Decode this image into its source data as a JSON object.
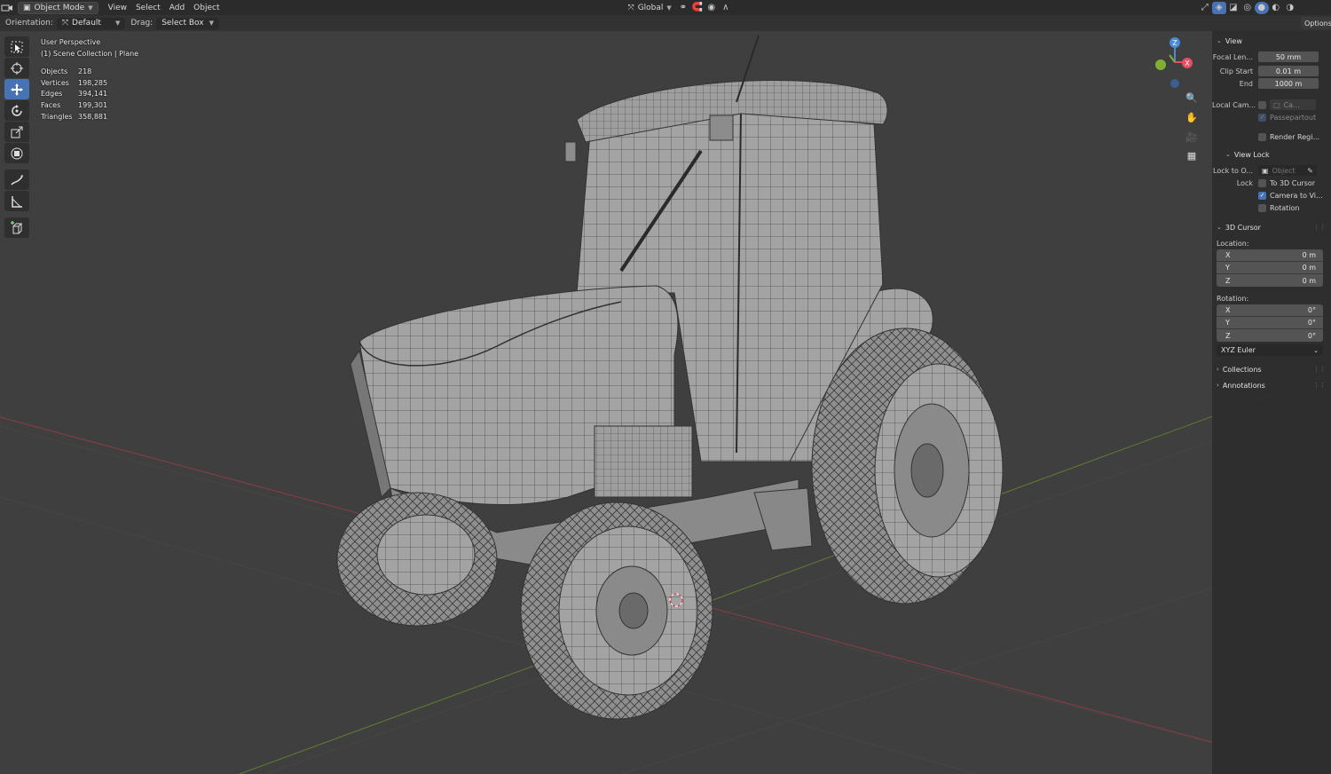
{
  "header": {
    "mode_label": "Object Mode",
    "menu": [
      "View",
      "Select",
      "Add",
      "Object"
    ],
    "transform_orientation": "Global"
  },
  "toolsettings": {
    "orientation_label": "Orientation:",
    "orientation_value": "Default",
    "drag_label": "Drag:",
    "drag_value": "Select Box"
  },
  "toolbar": {
    "tools": [
      "select-box",
      "cursor",
      "move",
      "rotate",
      "scale",
      "transform",
      "annotate",
      "measure",
      "add-cube"
    ],
    "active_tool": "move"
  },
  "overlay": {
    "view_name": "User Perspective",
    "collection": "(1) Scene Collection | Plane",
    "stats": [
      {
        "label": "Objects",
        "value": "218"
      },
      {
        "label": "Vertices",
        "value": "198,285"
      },
      {
        "label": "Edges",
        "value": "394,141"
      },
      {
        "label": "Faces",
        "value": "199,301"
      },
      {
        "label": "Triangles",
        "value": "358,881"
      }
    ]
  },
  "gizmo": {
    "z_label": "Z",
    "x_label": "X"
  },
  "sidebar": {
    "options_label": "Options",
    "view_panel": {
      "title": "View",
      "focal_label": "Focal Len...",
      "focal_value": "50 mm",
      "clip_start_label": "Clip Start",
      "clip_start_value": "0.01 m",
      "clip_end_label": "End",
      "clip_end_value": "1000 m",
      "local_cam_label": "Local Cam...",
      "local_cam_value": "Ca...",
      "passepartout_label": "Passepartout",
      "render_region_label": "Render Regi..."
    },
    "view_lock_panel": {
      "title": "View Lock",
      "lock_to_label": "Lock to O...",
      "lock_to_placeholder": "Object",
      "lock_label": "Lock",
      "to_3d_cursor": "To 3D Cursor",
      "camera_to_view": "Camera to Vi...",
      "rotation": "Rotation"
    },
    "cursor_panel": {
      "title": "3D Cursor",
      "location_label": "Location:",
      "location": [
        {
          "axis": "X",
          "value": "0 m"
        },
        {
          "axis": "Y",
          "value": "0 m"
        },
        {
          "axis": "Z",
          "value": "0 m"
        }
      ],
      "rotation_label": "Rotation:",
      "rotation": [
        {
          "axis": "X",
          "value": "0°"
        },
        {
          "axis": "Y",
          "value": "0°"
        },
        {
          "axis": "Z",
          "value": "0°"
        }
      ],
      "rotation_mode": "XYZ Euler"
    },
    "collections_title": "Collections",
    "annotations_title": "Annotations"
  },
  "colors": {
    "viewport_bg": "#3f3f3f",
    "accent": "#4772b3",
    "axis_x": "#e84d5f",
    "axis_y": "#7fb033",
    "axis_z": "#4a8ad8"
  }
}
